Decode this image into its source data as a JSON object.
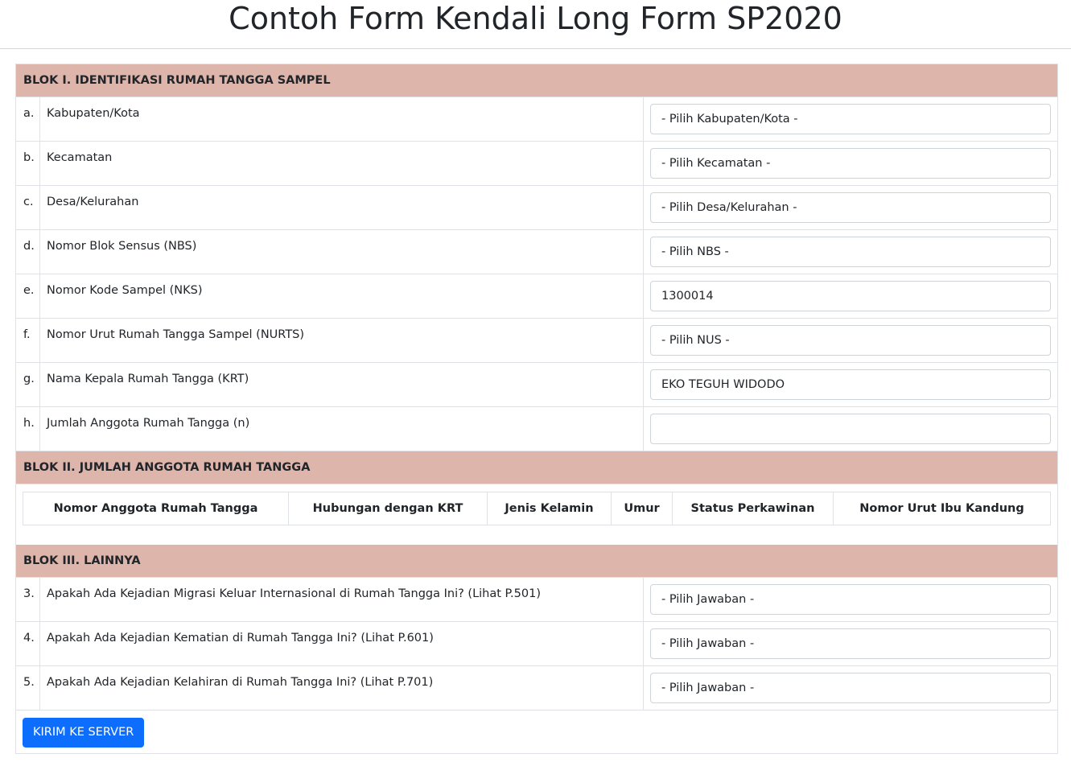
{
  "title": "Contoh Form Kendali Long Form SP2020",
  "blok1": {
    "title": "BLOK I. IDENTIFIKASI RUMAH TANGGA SAMPEL",
    "rows": [
      {
        "num": "a.",
        "label": "Kabupaten/Kota",
        "value": "- Pilih Kabupaten/Kota -"
      },
      {
        "num": "b.",
        "label": "Kecamatan",
        "value": "- Pilih Kecamatan -"
      },
      {
        "num": "c.",
        "label": "Desa/Kelurahan",
        "value": "- Pilih Desa/Kelurahan -"
      },
      {
        "num": "d.",
        "label": "Nomor Blok Sensus (NBS)",
        "value": "- Pilih NBS -"
      },
      {
        "num": "e.",
        "label": "Nomor Kode Sampel (NKS)",
        "value": "1300014"
      },
      {
        "num": "f.",
        "label": "Nomor Urut Rumah Tangga Sampel (NURTS)",
        "value": "- Pilih NUS -"
      },
      {
        "num": "g.",
        "label": "Nama Kepala Rumah Tangga (KRT)",
        "value": "EKO TEGUH WIDODO"
      },
      {
        "num": "h.",
        "label": "Jumlah Anggota Rumah Tangga (n)",
        "value": ""
      }
    ]
  },
  "blok2": {
    "title": "BLOK II. JUMLAH ANGGOTA RUMAH TANGGA",
    "columns": [
      "Nomor Anggota Rumah Tangga",
      "Hubungan dengan KRT",
      "Jenis Kelamin",
      "Umur",
      "Status Perkawinan",
      "Nomor Urut Ibu Kandung"
    ]
  },
  "blok3": {
    "title": "BLOK III. LAINNYA",
    "rows": [
      {
        "num": "3.",
        "label": "Apakah Ada Kejadian Migrasi Keluar Internasional di Rumah Tangga Ini? (Lihat P.501)",
        "value": "- Pilih Jawaban -"
      },
      {
        "num": "4.",
        "label": "Apakah Ada Kejadian Kematian di Rumah Tangga Ini? (Lihat P.601)",
        "value": "- Pilih Jawaban -"
      },
      {
        "num": "5.",
        "label": "Apakah Ada Kejadian Kelahiran di Rumah Tangga Ini? (Lihat P.701)",
        "value": "- Pilih Jawaban -"
      }
    ]
  },
  "submit_label": "KIRIM KE SERVER"
}
